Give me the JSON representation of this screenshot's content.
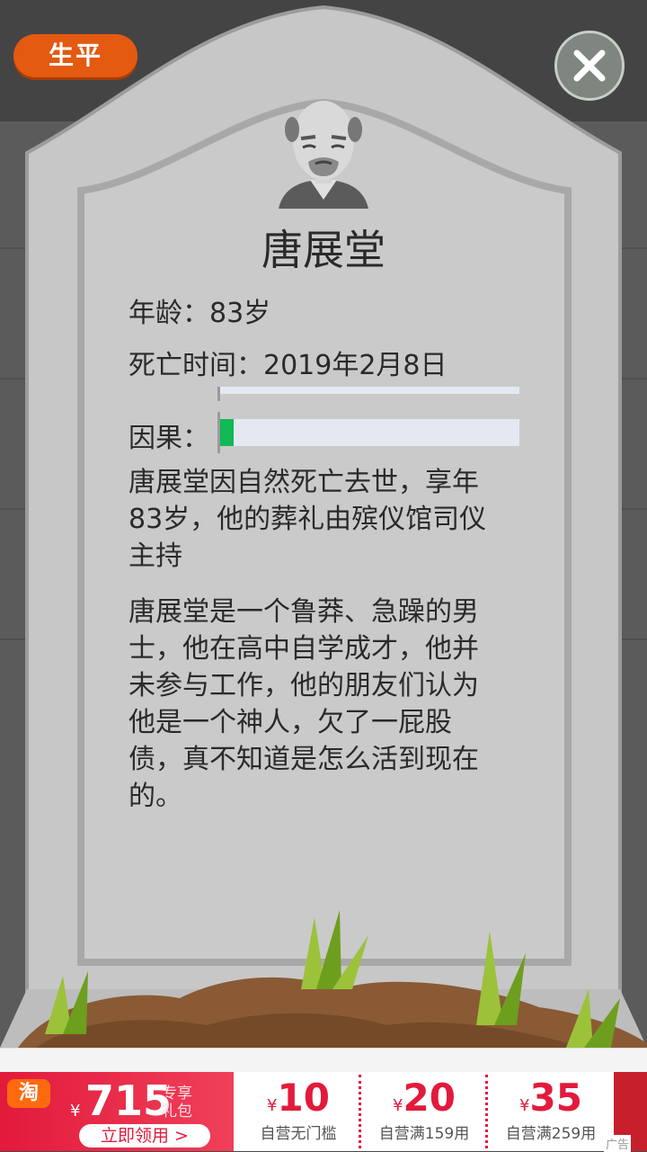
{
  "header": {
    "tab_label": "生平",
    "close_icon": "close-icon"
  },
  "profile": {
    "name": "唐展堂",
    "age_line": "年龄：83岁",
    "death_line": "死亡时间：2019年2月8日",
    "karma_label": "因果：",
    "karma_fraction": 0.05,
    "death_summary": "唐展堂因自然死亡去世，享年83岁，他的葬礼由殡仪馆司仪主持",
    "biography": "唐展堂是一个鲁莽、急躁的男士，他在高中自学成才，他并未参与工作，他的朋友们认为他是一个神人，欠了一屁股债，真不知道是怎么活到现在的。"
  },
  "ad": {
    "brand_icon": "淘",
    "main_currency": "¥",
    "main_amount": "715",
    "main_caption": "专享礼包",
    "main_button": "立即领用 >",
    "coupons": [
      {
        "currency": "¥",
        "amount": "10",
        "caption": "自营无门槛"
      },
      {
        "currency": "¥",
        "amount": "20",
        "caption": "自营满159用"
      },
      {
        "currency": "¥",
        "amount": "35",
        "caption": "自营满259用"
      }
    ],
    "ad_label": "广告"
  },
  "colors": {
    "accent_orange": "#e35a10",
    "karma_green": "#10b856",
    "ad_red": "#e21a3c"
  }
}
